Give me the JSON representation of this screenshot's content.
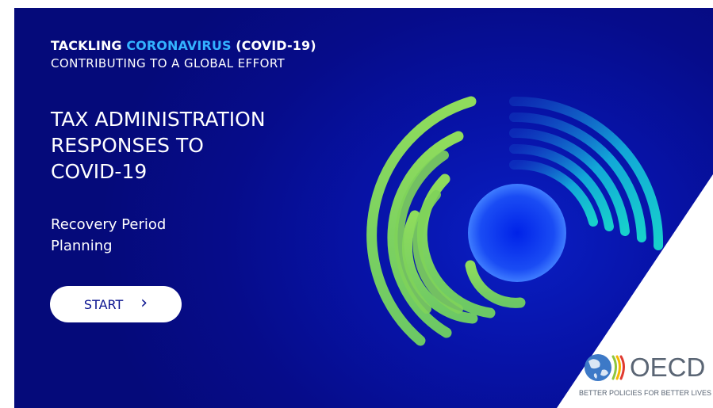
{
  "header": {
    "line1_prefix": "TACKLING ",
    "line1_accent": "CORONAVIRUS",
    "line1_suffix": " (COVID-19)",
    "line2": "CONTRIBUTING TO A GLOBAL EFFORT"
  },
  "title": {
    "line1": "TAX ADMINISTRATION",
    "line2": "RESPONSES TO",
    "line3": "COVID-19"
  },
  "subtitle": {
    "line1": "Recovery Period",
    "line2": "Planning"
  },
  "start_button": {
    "label": "START",
    "icon": "chevron-right-icon"
  },
  "logo": {
    "name": "OECD",
    "tagline": "BETTER POLICIES FOR BETTER LIVES",
    "icon": "globe-icon"
  },
  "colors": {
    "background": "#060c8a",
    "accent": "#33b2ff",
    "green": "#7fd35a",
    "teal": "#15c2d0",
    "logo_text": "#5a6574"
  }
}
